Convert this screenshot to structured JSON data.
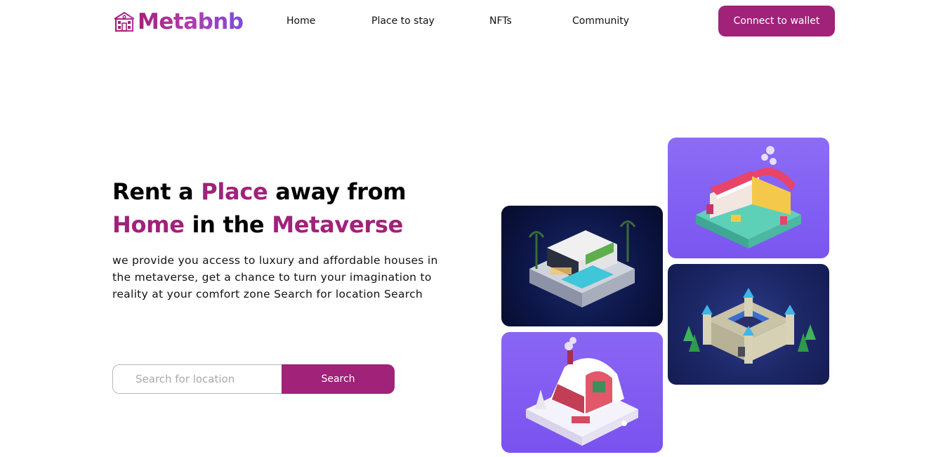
{
  "header": {
    "logo_text": "Metabnb",
    "logo_icon": "house-icon",
    "nav": [
      {
        "label": "Home"
      },
      {
        "label": "Place to stay"
      },
      {
        "label": "NFTs"
      },
      {
        "label": "Community"
      }
    ],
    "wallet_button": "Connect to wallet"
  },
  "hero": {
    "headline": {
      "part1": "Rent a ",
      "part2": "Place",
      "part3": " away from",
      "part4": "Home",
      "part5": " in the ",
      "part6": "Metaverse"
    },
    "description": "we provide you access to luxury and affordable houses in the metaverse, get a chance to turn your imagination to reality at your comfort zone Search for location Search",
    "search": {
      "placeholder": "Search for location",
      "button": "Search"
    }
  },
  "colors": {
    "accent": "#a02279",
    "logo_gradient_end": "#7d4cd9"
  }
}
